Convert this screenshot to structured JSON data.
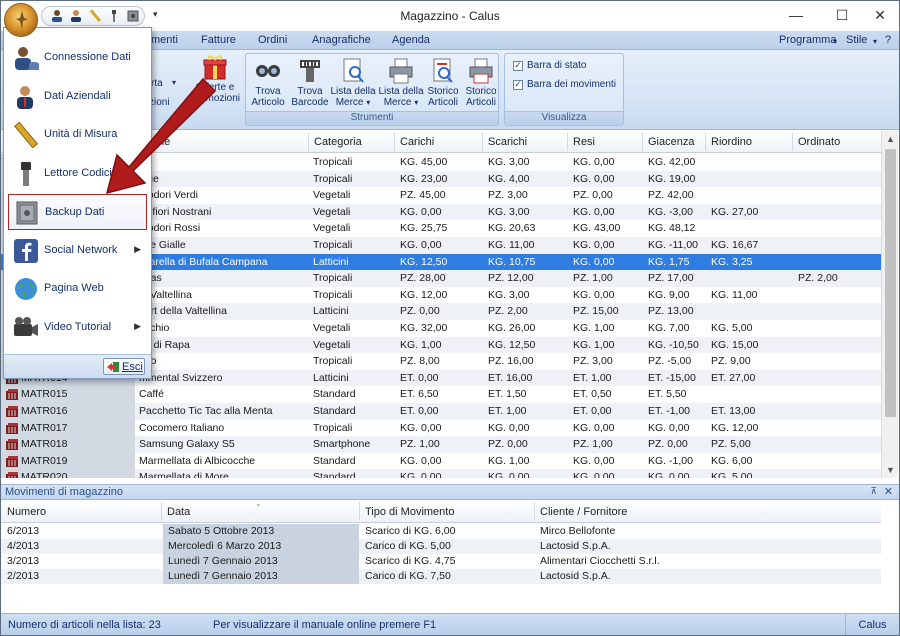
{
  "window": {
    "title": "Magazzino - Calus"
  },
  "window_controls": {
    "minimize": "—",
    "maximize": "☐",
    "close": "✕"
  },
  "qat": {
    "dropdown": "▾"
  },
  "tabs": [
    {
      "label": "menti"
    },
    {
      "label": "Fatture"
    },
    {
      "label": "Ordini"
    },
    {
      "label": "Anagrafiche"
    },
    {
      "label": "Agenda"
    }
  ],
  "tabs_right": {
    "programma": "Programma",
    "stile": "Stile",
    "help": "?"
  },
  "ribbon": {
    "partial_labels": {
      "a": "rta",
      "b": "zioni"
    },
    "offerte": {
      "line1": "Offerte e",
      "line2": "Promozioni"
    },
    "strumenti": {
      "label": "Strumenti",
      "buttons": [
        {
          "line1": "Trova",
          "line2": "Articolo"
        },
        {
          "line1": "Trova",
          "line2": "Barcode"
        },
        {
          "line1": "Lista della",
          "line2": "Merce"
        },
        {
          "line1": "Lista della",
          "line2": "Merce"
        },
        {
          "line1": "Storico",
          "line2": "Articoli"
        },
        {
          "line1": "Storico",
          "line2": "Articoli"
        }
      ]
    },
    "visualizza": {
      "label": "Visualizza",
      "checks": [
        {
          "label": "Barra di stato",
          "checked": true
        },
        {
          "label": "Barra dei movimenti",
          "checked": true
        }
      ]
    }
  },
  "grid": {
    "columns": [
      "zione",
      "Categoria",
      "Carichi",
      "Scarichi",
      "Resi",
      "Giacenza",
      "Riordino",
      "Ordinato"
    ],
    "rows": [
      {
        "code": "",
        "desc": "ne",
        "cat": "Tropicali",
        "carichi": "KG. 45,00",
        "scarichi": "KG. 3,00",
        "resi": "KG. 0,00",
        "giac": "KG. 42,00",
        "riord": "",
        "ord": ""
      },
      {
        "code": "",
        "desc": "egie",
        "cat": "Tropicali",
        "carichi": "KG. 23,00",
        "scarichi": "KG. 4,00",
        "resi": "KG. 0,00",
        "giac": "KG. 19,00",
        "riord": "",
        "ord": ""
      },
      {
        "code": "",
        "desc": "modori Verdi",
        "cat": "Vegetali",
        "carichi": "PZ. 45,00",
        "scarichi": "PZ. 3,00",
        "resi": "PZ. 0,00",
        "giac": "PZ. 42,00",
        "riord": "",
        "ord": ""
      },
      {
        "code": "",
        "desc": "volfiori Nostrani",
        "cat": "Vegetali",
        "carichi": "KG. 0,00",
        "scarichi": "KG. 3,00",
        "resi": "KG. 0,00",
        "giac": "KG. -3,00",
        "riord": "KG. 27,00",
        "ord": ""
      },
      {
        "code": "",
        "desc": "modori Rossi",
        "cat": "Vegetali",
        "carichi": "KG. 25,75",
        "scarichi": "KG. 20,63",
        "resi": "KG. 43,00",
        "giac": "KG. 48,12",
        "riord": "",
        "ord": ""
      },
      {
        "code": "",
        "desc": "che Gialle",
        "cat": "Tropicali",
        "carichi": "KG. 0,00",
        "scarichi": "KG. 11,00",
        "resi": "KG. 0,00",
        "giac": "KG. -11,00",
        "riord": "KG. 16,67",
        "ord": ""
      },
      {
        "code": "",
        "desc": "zzarella di Bufala Campana",
        "cat": "Latticini",
        "carichi": "KG. 12,50",
        "scarichi": "KG. 10,75",
        "resi": "KG. 0,00",
        "giac": "KG. 1,75",
        "riord": "KG. 3,25",
        "ord": ""
      },
      {
        "code": "",
        "desc": "anas",
        "cat": "Tropicali",
        "carichi": "PZ. 28,00",
        "scarichi": "PZ. 12,00",
        "resi": "PZ. 1,00",
        "giac": "PZ. 17,00",
        "riord": "",
        "ord": "PZ. 2,00"
      },
      {
        "code": "",
        "desc": "le Valtellina",
        "cat": "Tropicali",
        "carichi": "KG. 12,00",
        "scarichi": "KG. 3,00",
        "resi": "KG. 0,00",
        "giac": "KG. 9,00",
        "riord": "KG. 11,00",
        "ord": ""
      },
      {
        "code": "",
        "desc": "gurt della Valtellina",
        "cat": "Latticini",
        "carichi": "PZ. 0,00",
        "scarichi": "PZ. 2,00",
        "resi": "PZ. 15,00",
        "giac": "PZ. 13,00",
        "riord": "",
        "ord": ""
      },
      {
        "code": "",
        "desc": "occhio",
        "cat": "Vegetali",
        "carichi": "KG. 32,00",
        "scarichi": "KG. 26,00",
        "resi": "KG. 1,00",
        "giac": "KG. 7,00",
        "riord": "KG. 5,00",
        "ord": ""
      },
      {
        "code": "",
        "desc": "ne di Rapa",
        "cat": "Vegetali",
        "carichi": "KG. 1,00",
        "scarichi": "KG. 12,50",
        "resi": "KG. 1,00",
        "giac": "KG. -10,50",
        "riord": "KG. 15,00",
        "ord": ""
      },
      {
        "code": "",
        "desc": "ngo",
        "cat": "Tropicali",
        "carichi": "PZ. 8,00",
        "scarichi": "PZ. 16,00",
        "resi": "PZ. 3,00",
        "giac": "PZ. -5,00",
        "riord": "PZ. 9,00",
        "ord": ""
      },
      {
        "code": "MATR014",
        "desc": "mmental Svizzero",
        "cat": "Latticini",
        "carichi": "ET. 0,00",
        "scarichi": "ET. 16,00",
        "resi": "ET. 1,00",
        "giac": "ET. -15,00",
        "riord": "ET. 27,00",
        "ord": ""
      },
      {
        "code": "MATR015",
        "desc": "Caffé",
        "cat": "Standard",
        "carichi": "ET. 6,50",
        "scarichi": "ET. 1,50",
        "resi": "ET. 0,50",
        "giac": "ET. 5,50",
        "riord": "",
        "ord": ""
      },
      {
        "code": "MATR016",
        "desc": "Pacchetto Tic Tac alla Menta",
        "cat": "Standard",
        "carichi": "ET. 0,00",
        "scarichi": "ET. 1,00",
        "resi": "ET. 0,00",
        "giac": "ET. -1,00",
        "riord": "ET. 13,00",
        "ord": ""
      },
      {
        "code": "MATR017",
        "desc": "Cocomero Italiano",
        "cat": "Tropicali",
        "carichi": "KG. 0,00",
        "scarichi": "KG. 0,00",
        "resi": "KG. 0,00",
        "giac": "KG. 0,00",
        "riord": "KG. 12,00",
        "ord": ""
      },
      {
        "code": "MATR018",
        "desc": "Samsung Galaxy S5",
        "cat": "Smartphone",
        "carichi": "PZ. 1,00",
        "scarichi": "PZ. 0,00",
        "resi": "PZ. 1,00",
        "giac": "PZ. 0,00",
        "riord": "PZ. 5,00",
        "ord": ""
      },
      {
        "code": "MATR019",
        "desc": "Marmellata di Albicocche",
        "cat": "Standard",
        "carichi": "KG. 0,00",
        "scarichi": "KG. 1,00",
        "resi": "KG. 0,00",
        "giac": "KG. -1,00",
        "riord": "KG. 6,00",
        "ord": ""
      },
      {
        "code": "MATR020",
        "desc": "Marmellata di More",
        "cat": "Standard",
        "carichi": "KG. 0,00",
        "scarichi": "KG. 0,00",
        "resi": "KG. 0,00",
        "giac": "KG. 0,00",
        "riord": "KG. 5,00",
        "ord": ""
      }
    ],
    "scroll": {
      "up": "▲",
      "down": "▼"
    }
  },
  "movimenti": {
    "title": "Movimenti di magazzino",
    "pin": "⊼",
    "close": "✕",
    "columns": [
      "Numero",
      "Data",
      "Tipo di Movimento",
      "Cliente / Fornitore"
    ],
    "rows": [
      {
        "num": "6/2013",
        "data": "Sabato  5 Ottobre 2013",
        "tipo": "Scarico di KG. 6,00",
        "cliente": "Mirco Bellofonte"
      },
      {
        "num": "4/2013",
        "data": "Mercoledì  6 Marzo 2013",
        "tipo": "Carico di KG. 5,00",
        "cliente": "Lactosid S.p.A."
      },
      {
        "num": "3/2013",
        "data": "Lunedì  7 Gennaio 2013",
        "tipo": "Scarico di KG. 4,75",
        "cliente": "Alimentari Ciocchetti S.r.l."
      },
      {
        "num": "2/2013",
        "data": "Lunedì  7 Gennaio 2013",
        "tipo": "Carico di KG. 7,50",
        "cliente": "Lactosid S.p.A."
      }
    ]
  },
  "status": {
    "count": "Numero di articoli nella lista: 23",
    "hint": "Per visualizzare il manuale online premere F1",
    "app": "Calus"
  },
  "app_menu": {
    "items": [
      {
        "label": "Connessione Dati",
        "icon": "users-db-icon",
        "submenu": false
      },
      {
        "label": "Dati Aziendali",
        "icon": "user-company-icon",
        "submenu": false
      },
      {
        "label": "Unità di Misura",
        "icon": "ruler-icon",
        "submenu": false
      },
      {
        "label": "Lettore Codici",
        "icon": "barcode-reader-icon",
        "submenu": false
      },
      {
        "label": "Backup Dati",
        "icon": "safe-icon",
        "submenu": false,
        "highlighted": true
      },
      {
        "label": "Social Network",
        "icon": "facebook-icon",
        "submenu": true
      },
      {
        "label": "Pagina Web",
        "icon": "globe-icon",
        "submenu": false
      },
      {
        "label": "Video Tutorial",
        "icon": "video-camera-icon",
        "submenu": true
      }
    ],
    "submenu_arrow": "▶",
    "exit": "Esci"
  },
  "colors": {
    "selection": "#2f7de1",
    "highlight_border": "#b22525",
    "arrow": "#b01c1c"
  }
}
